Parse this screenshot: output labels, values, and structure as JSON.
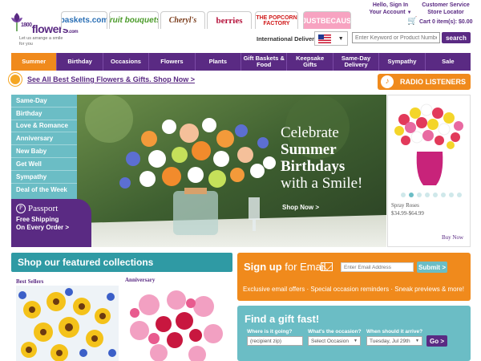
{
  "logo": {
    "wordmark": "1800",
    "wordmark_sub": "flowers",
    "tagline": "Let us arrange a smile for you"
  },
  "brands": {
    "baskets": "baskets.com",
    "fruit": "fruit bouquets",
    "cheryls": "Cheryl's",
    "berries": "berries",
    "popcorn": "THE POPCORN FACTORY",
    "cause": "#JUSTBECAUSE"
  },
  "account": {
    "hello": "Hello, Sign In",
    "your_account": "Your Account",
    "customer_service": "Customer Service",
    "store_locator": "Store Locator",
    "cart": "Cart 0 item(s): $0.00"
  },
  "header": {
    "intl_label": "International Delivery",
    "search_placeholder": "Enter Keyword or Product Number",
    "search_label": "search"
  },
  "nav": [
    {
      "label": "Summer"
    },
    {
      "label": "Birthday"
    },
    {
      "label": "Occasions"
    },
    {
      "label": "Flowers"
    },
    {
      "label": "Plants"
    },
    {
      "label": "Gift Baskets & Food"
    },
    {
      "label": "Keepsake Gifts"
    },
    {
      "label": "Same-Day Delivery"
    },
    {
      "label": "Sympathy"
    },
    {
      "label": "Sale"
    }
  ],
  "promo": {
    "text": "See All Best Selling Flowers & Gifts. Shop Now >",
    "radio": "RADIO LISTENERS"
  },
  "side_menu": [
    "Same-Day",
    "Birthday",
    "Love & Romance",
    "Anniversary",
    "New Baby",
    "Get Well",
    "Sympathy",
    "Deal of the Week"
  ],
  "passport": {
    "logo": "Passport",
    "line1": "Free Shipping",
    "line2": "On Every Order >"
  },
  "hero": {
    "line1": "Celebrate",
    "line2": "Summer",
    "line3": "Birthdays",
    "line4": "with a Smile!",
    "cta": "Shop Now >"
  },
  "side_card": {
    "name": "Spray Roses",
    "price": "$34.99-$64.99",
    "cta": "Buy Now"
  },
  "featured": {
    "title": "Shop our featured collections",
    "best": "Best Sellers",
    "anniversary": "Anniversary"
  },
  "email": {
    "title_bold": "Sign up",
    "title_rest": " for Email",
    "placeholder": "Enter Email Address",
    "submit": "Submit >",
    "perks": "Exclusive email offers · Special occasion reminders · Sneak previews & more!"
  },
  "gift": {
    "title": "Find a gift fast!",
    "where_label": "Where is it going?",
    "where_value": "(recipient zip)",
    "occasion_label": "What's the occasion?",
    "occasion_value": "Select Occasion",
    "when_label": "When should it arrive?",
    "when_value": "Tuesday, Jul 29th",
    "go": "Go >"
  },
  "colors": {
    "purple": "#5a2a83",
    "orange": "#f08a1c",
    "teal": "#6bbdc5",
    "teal_dark": "#2f9aa4"
  }
}
